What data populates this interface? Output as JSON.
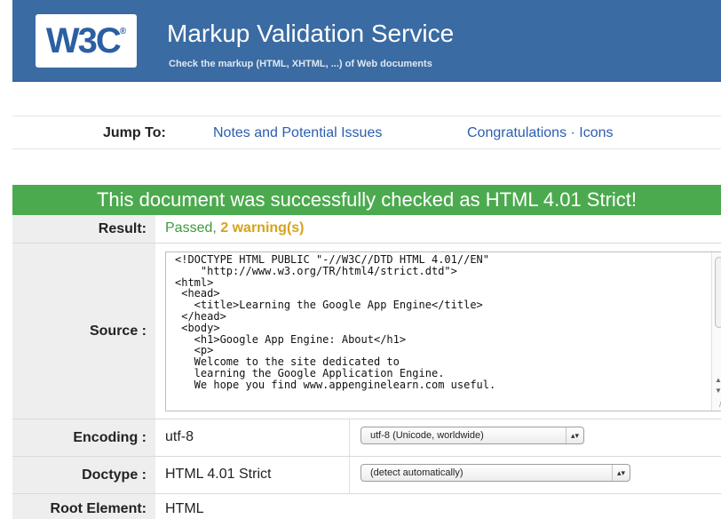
{
  "header": {
    "logo_text": "W3C",
    "logo_mark": "®",
    "title": "Markup Validation Service",
    "subtitle": "Check the markup (HTML, XHTML, ...) of Web documents"
  },
  "jumpbar": {
    "label": "Jump To:",
    "links": [
      "Notes and Potential Issues",
      "Congratulations · Icons"
    ]
  },
  "result_banner": "This document was successfully checked as HTML 4.01 Strict!",
  "table": {
    "result": {
      "label": "Result:",
      "status": "Passed,",
      "warnings": "2 warning(s)"
    },
    "source": {
      "label": "Source :",
      "code": "<!DOCTYPE HTML PUBLIC \"-//W3C//DTD HTML 4.01//EN\"\n    \"http://www.w3.org/TR/html4/strict.dtd\">\n<html>\n <head>\n   <title>Learning the Google App Engine</title>\n </head>\n <body>\n   <h1>Google App Engine: About</h1>\n   <p>\n   Welcome to the site dedicated to\n   learning the Google Application Engine.\n   We hope you find www.appenginelearn.com useful."
    },
    "encoding": {
      "label": "Encoding :",
      "value": "utf-8",
      "select": "utf-8 (Unicode, worldwide)"
    },
    "doctype": {
      "label": "Doctype :",
      "value": "HTML 4.01 Strict",
      "select": "(detect automatically)"
    },
    "root": {
      "label": "Root Element:",
      "value": "HTML"
    }
  },
  "colors": {
    "banner": "#3a6ba2",
    "success": "#4caa4e",
    "link": "#2a5db0",
    "passed": "#3d9a3d",
    "warning": "#d6a31b"
  },
  "icons": [
    "select-arrows-icon",
    "scroll-up-icon",
    "scroll-down-icon",
    "resize-grip-icon"
  ]
}
